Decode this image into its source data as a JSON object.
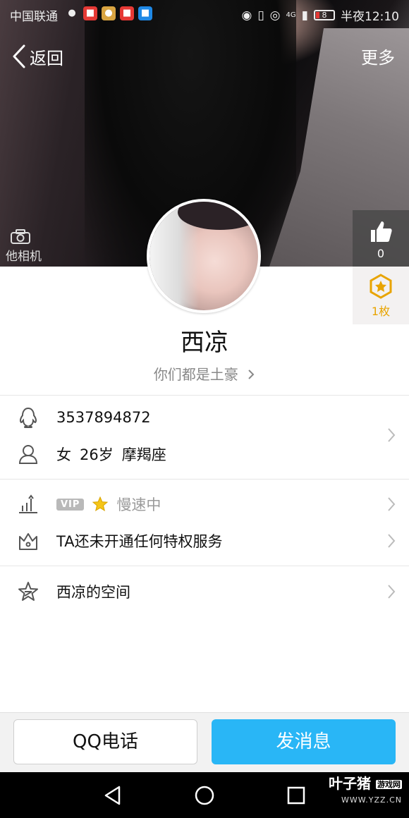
{
  "status_bar": {
    "carrier": "中国联通",
    "time": "半夜12:10",
    "battery": "8",
    "network": "4G"
  },
  "nav": {
    "back_label": "返回",
    "more_label": "更多"
  },
  "cover": {
    "camera_label": "他相机"
  },
  "likes": {
    "count": "0"
  },
  "badges": {
    "count": "1枚"
  },
  "profile": {
    "name": "西凉",
    "relation": "你们都是土豪"
  },
  "info": {
    "qq_number": "3537894872",
    "gender": "女",
    "age": "26岁",
    "zodiac": "摩羯座"
  },
  "vip": {
    "badge": "VIP",
    "status": "慢速中"
  },
  "privilege": {
    "text": "TA还未开通任何特权服务"
  },
  "space": {
    "text": "西凉的空间"
  },
  "actions": {
    "call_label": "QQ电话",
    "message_label": "发消息"
  },
  "watermark": {
    "title": "叶子猪",
    "tag": "游戏网",
    "url": "WWW.YZZ.CN"
  },
  "colors": {
    "accent": "#29b6f6",
    "badge": "#e8a400"
  }
}
